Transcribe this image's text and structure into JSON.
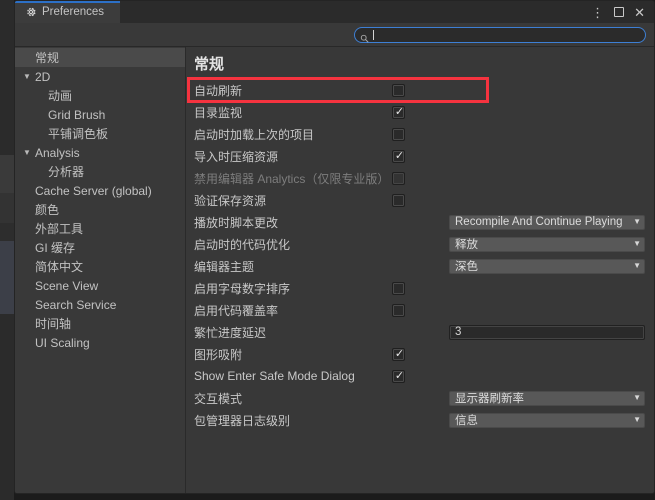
{
  "window": {
    "tab_title": "Preferences",
    "tab_icon": "gear-icon",
    "controls": {
      "kebab": "⋮",
      "maximize": "",
      "close": "✕"
    }
  },
  "search": {
    "icon": "search-icon",
    "value": "",
    "placeholder": ""
  },
  "sidebar": {
    "items": [
      {
        "label": "常规",
        "level": 0,
        "arrow": "",
        "selected": true
      },
      {
        "label": "2D",
        "level": 0,
        "arrow": "▼",
        "selected": false
      },
      {
        "label": "动画",
        "level": 1,
        "arrow": "",
        "selected": false
      },
      {
        "label": "Grid Brush",
        "level": 1,
        "arrow": "",
        "selected": false
      },
      {
        "label": "平铺调色板",
        "level": 1,
        "arrow": "",
        "selected": false
      },
      {
        "label": "Analysis",
        "level": 0,
        "arrow": "▼",
        "selected": false
      },
      {
        "label": "分析器",
        "level": 1,
        "arrow": "",
        "selected": false
      },
      {
        "label": "Cache Server (global)",
        "level": 0,
        "arrow": "",
        "selected": false
      },
      {
        "label": "颜色",
        "level": 0,
        "arrow": "",
        "selected": false
      },
      {
        "label": "外部工具",
        "level": 0,
        "arrow": "",
        "selected": false
      },
      {
        "label": "GI 缓存",
        "level": 0,
        "arrow": "",
        "selected": false
      },
      {
        "label": "简体中文",
        "level": 0,
        "arrow": "",
        "selected": false
      },
      {
        "label": "Scene View",
        "level": 0,
        "arrow": "",
        "selected": false
      },
      {
        "label": "Search Service",
        "level": 0,
        "arrow": "",
        "selected": false
      },
      {
        "label": "时间轴",
        "level": 0,
        "arrow": "",
        "selected": false
      },
      {
        "label": "UI Scaling",
        "level": 0,
        "arrow": "",
        "selected": false
      }
    ]
  },
  "main": {
    "title": "常规",
    "rows": [
      {
        "label": "自动刷新",
        "type": "checkbox",
        "checked": false,
        "disabled": false,
        "highlighted": true
      },
      {
        "label": "目录监视",
        "type": "checkbox",
        "checked": true,
        "disabled": false,
        "highlighted": false
      },
      {
        "label": "启动时加载上次的项目",
        "type": "checkbox",
        "checked": false,
        "disabled": false,
        "highlighted": false
      },
      {
        "label": "导入时压缩资源",
        "type": "checkbox",
        "checked": true,
        "disabled": false,
        "highlighted": false
      },
      {
        "label": "禁用编辑器 Analytics（仅限专业版）",
        "type": "checkbox",
        "checked": false,
        "disabled": true,
        "highlighted": false
      },
      {
        "label": "验证保存资源",
        "type": "checkbox",
        "checked": false,
        "disabled": false,
        "highlighted": false
      },
      {
        "label": "播放时脚本更改",
        "type": "dropdown",
        "value": "Recompile And Continue Playing",
        "disabled": false,
        "highlighted": false
      },
      {
        "label": "启动时的代码优化",
        "type": "dropdown",
        "value": "释放",
        "disabled": false,
        "highlighted": false
      },
      {
        "label": "编辑器主题",
        "type": "dropdown",
        "value": "深色",
        "disabled": false,
        "highlighted": false
      },
      {
        "label": "启用字母数字排序",
        "type": "checkbox",
        "checked": false,
        "disabled": false,
        "highlighted": false
      },
      {
        "label": "启用代码覆盖率",
        "type": "checkbox",
        "checked": false,
        "disabled": false,
        "highlighted": false
      },
      {
        "label": "繁忙进度延迟",
        "type": "textfield",
        "value": "3",
        "disabled": false,
        "highlighted": false
      },
      {
        "label": "图形吸附",
        "type": "checkbox",
        "checked": true,
        "disabled": false,
        "highlighted": false
      },
      {
        "label": "Show Enter Safe Mode Dialog",
        "type": "checkbox",
        "checked": true,
        "disabled": false,
        "highlighted": false
      },
      {
        "label": "交互模式",
        "type": "dropdown",
        "value": "显示器刷新率",
        "disabled": false,
        "highlighted": false
      },
      {
        "label": "包管理器日志级别",
        "type": "dropdown",
        "value": "信息",
        "disabled": false,
        "highlighted": false
      }
    ]
  },
  "annotation": {
    "color": "#f5333f",
    "target": "自动刷新"
  },
  "colors": {
    "window_bg": "#383838",
    "sidebar_bg": "#393939",
    "titlebar_bg": "#2b2b2b",
    "tab_bg": "#3c3c3c",
    "tab_accent": "#2c70c7",
    "selection": "#4a4a4a",
    "dropdown_bg": "#585858",
    "field_bg": "#2a2a2a",
    "text": "#c8c8c8",
    "text_disabled": "#7d7d7d",
    "focus_border": "#3d7fd4"
  }
}
